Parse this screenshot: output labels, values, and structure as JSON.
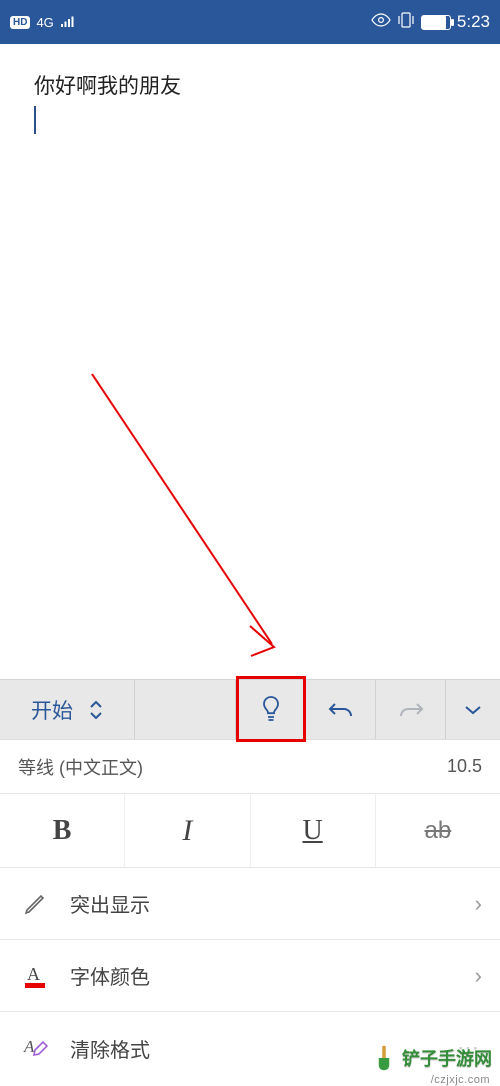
{
  "status": {
    "hd": "HD",
    "net": "4G",
    "time": "5:23"
  },
  "doc": {
    "text": "你好啊我的朋友"
  },
  "toolbar": {
    "start_label": "开始"
  },
  "font": {
    "name": "等线 (中文正文)",
    "size": "10.5"
  },
  "format": {
    "bold": "B",
    "italic": "I",
    "underline": "U",
    "strike": "ab"
  },
  "options": {
    "highlight": "突出显示",
    "font_color": "字体颜色",
    "clear_format": "清除格式"
  },
  "watermark": {
    "text": "铲子手游网",
    "url": "/czjxjc.com"
  }
}
